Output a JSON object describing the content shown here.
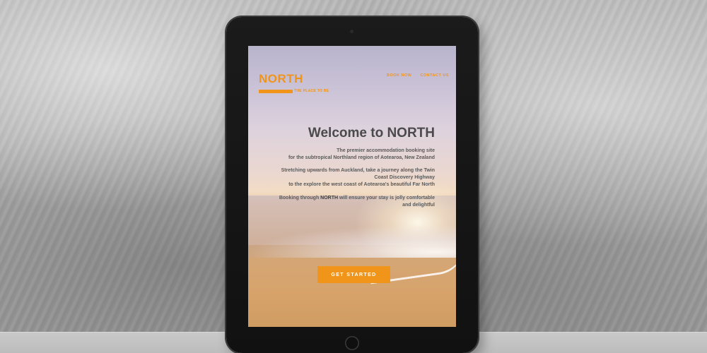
{
  "site": {
    "logo_text": "NORTH",
    "tagline": "THE PLACE TO BE",
    "accent_color": "#f0951a"
  },
  "nav": {
    "items": [
      {
        "label": "BOOK NOW"
      },
      {
        "label": "CONTACT US"
      }
    ]
  },
  "hero": {
    "title": "Welcome to NORTH",
    "paragraph1_line1": "The premier accommodation booking site",
    "paragraph1_line2": "for the subtropical Northland region of Aotearoa, New Zealand",
    "paragraph2_line1": "Stretching upwards from Auckland, take a journey along the Twin",
    "paragraph2_line2": "Coast Discovery Highway",
    "paragraph2_line3": "to the explore the west coast of Aotearoa's beautiful Far North",
    "paragraph3_prefix": "Booking through ",
    "paragraph3_brand": "NORTH",
    "paragraph3_suffix": " will ensure your stay is jolly comfortable",
    "paragraph3_line2": "and delightful",
    "cta_label": "GET STARTED"
  }
}
